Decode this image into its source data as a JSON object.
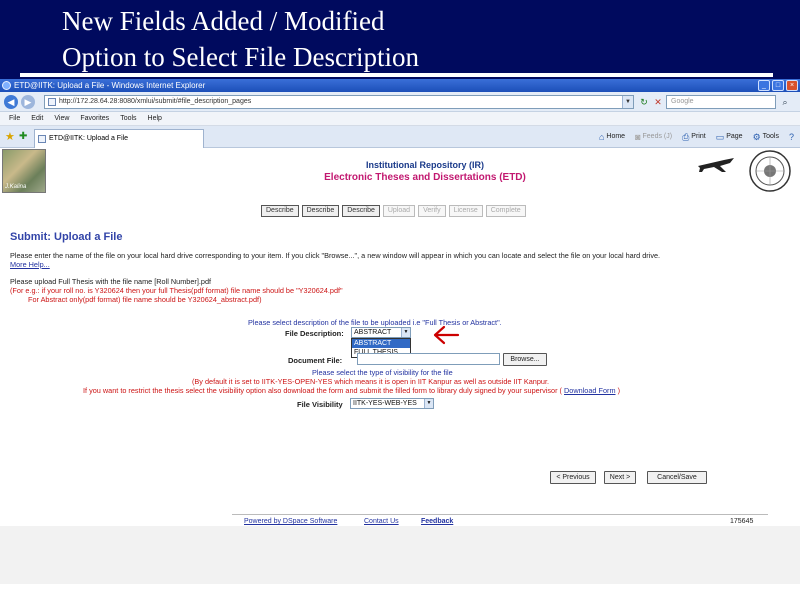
{
  "slide": {
    "title_line1": "New Fields Added / Modified",
    "title_line2": "Option to Select File Description"
  },
  "browser": {
    "window_title": "ETD@IITK: Upload a File - Windows Internet Explorer",
    "address": "http://172.28.64.28:8080/xmlui/submit/#file_description_pages",
    "search_placeholder": "Google",
    "menu": [
      "File",
      "Edit",
      "View",
      "Favorites",
      "Tools",
      "Help"
    ],
    "tab_title": "ETD@IITK: Upload a File",
    "commands": [
      {
        "label": "Home",
        "icon": "home-icon"
      },
      {
        "label": "Feeds (J)",
        "icon": "feeds-icon"
      },
      {
        "label": "Print",
        "icon": "print-icon"
      },
      {
        "label": "Page",
        "icon": "page-icon"
      },
      {
        "label": "Tools",
        "icon": "tools-icon"
      }
    ]
  },
  "header": {
    "photo_caption": "J.Kalina",
    "title_line1": "Institutional Repository (IR)",
    "title_line2": "Electronic Theses and Dissertations (ETD)"
  },
  "steps": [
    {
      "label": "Describe",
      "active": true
    },
    {
      "label": "Describe",
      "active": true
    },
    {
      "label": "Describe",
      "active": true
    },
    {
      "label": "Upload",
      "active": false
    },
    {
      "label": "Verify",
      "active": false
    },
    {
      "label": "License",
      "active": false
    },
    {
      "label": "Complete",
      "active": false
    }
  ],
  "form": {
    "heading": "Submit: Upload a File",
    "intro": "Please enter the name of the file on your local hard drive corresponding to your item. If you click \"Browse...\", a new window will appear in which you can locate and select the file on your local hard drive.",
    "more_help": "More Help...",
    "upload_note1": "Please upload Full Thesis with the file name [Roll Number].pdf",
    "upload_note2": "(For e.g.: if your roll no. is Y320624 then your full Thesis(pdf format) file name should be \"Y320624.pdf\"",
    "upload_note3": "For Abstract only(pdf format) file name should be Y320624_abstract.pdf)",
    "describe_note": "Please select description of the file to be uploaded i.e \"Full Thesis or Abstract\".",
    "file_description_label": "File Description:",
    "file_description_value": "ABSTRACT",
    "file_description_options": [
      "ABSTRACT",
      "FULL THESIS"
    ],
    "document_file_label": "Document File:",
    "browse_label": "Browse...",
    "visibility_note1": "Please select the type of visibility for the file",
    "visibility_note2": "(By default it is set to IITK-YES-OPEN-YES which means it is open in IIT Kanpur as well as outside IIT Kanpur.",
    "visibility_note3": "If you want to restrict the thesis select the visibility option also download the form and submit the filled form to library duly signed by your supervisor (",
    "download_form": "Download Form",
    "visibility_note3_end": ")",
    "visibility_label": "File Visibility",
    "visibility_value": "IITK-YES-WEB-YES",
    "previous_label": "< Previous",
    "next_label": "Next >",
    "cancel_label": "Cancel/Save"
  },
  "footer": {
    "powered": "Powered by DSpace Software",
    "contact": "Contact Us",
    "feedback": "Feedback",
    "counter": "175645"
  },
  "colors": {
    "slide_bg": "#000a5e",
    "heading_blue": "#3244a8",
    "note_red": "#cc1414",
    "annotation_arrow": "#cc0000"
  }
}
